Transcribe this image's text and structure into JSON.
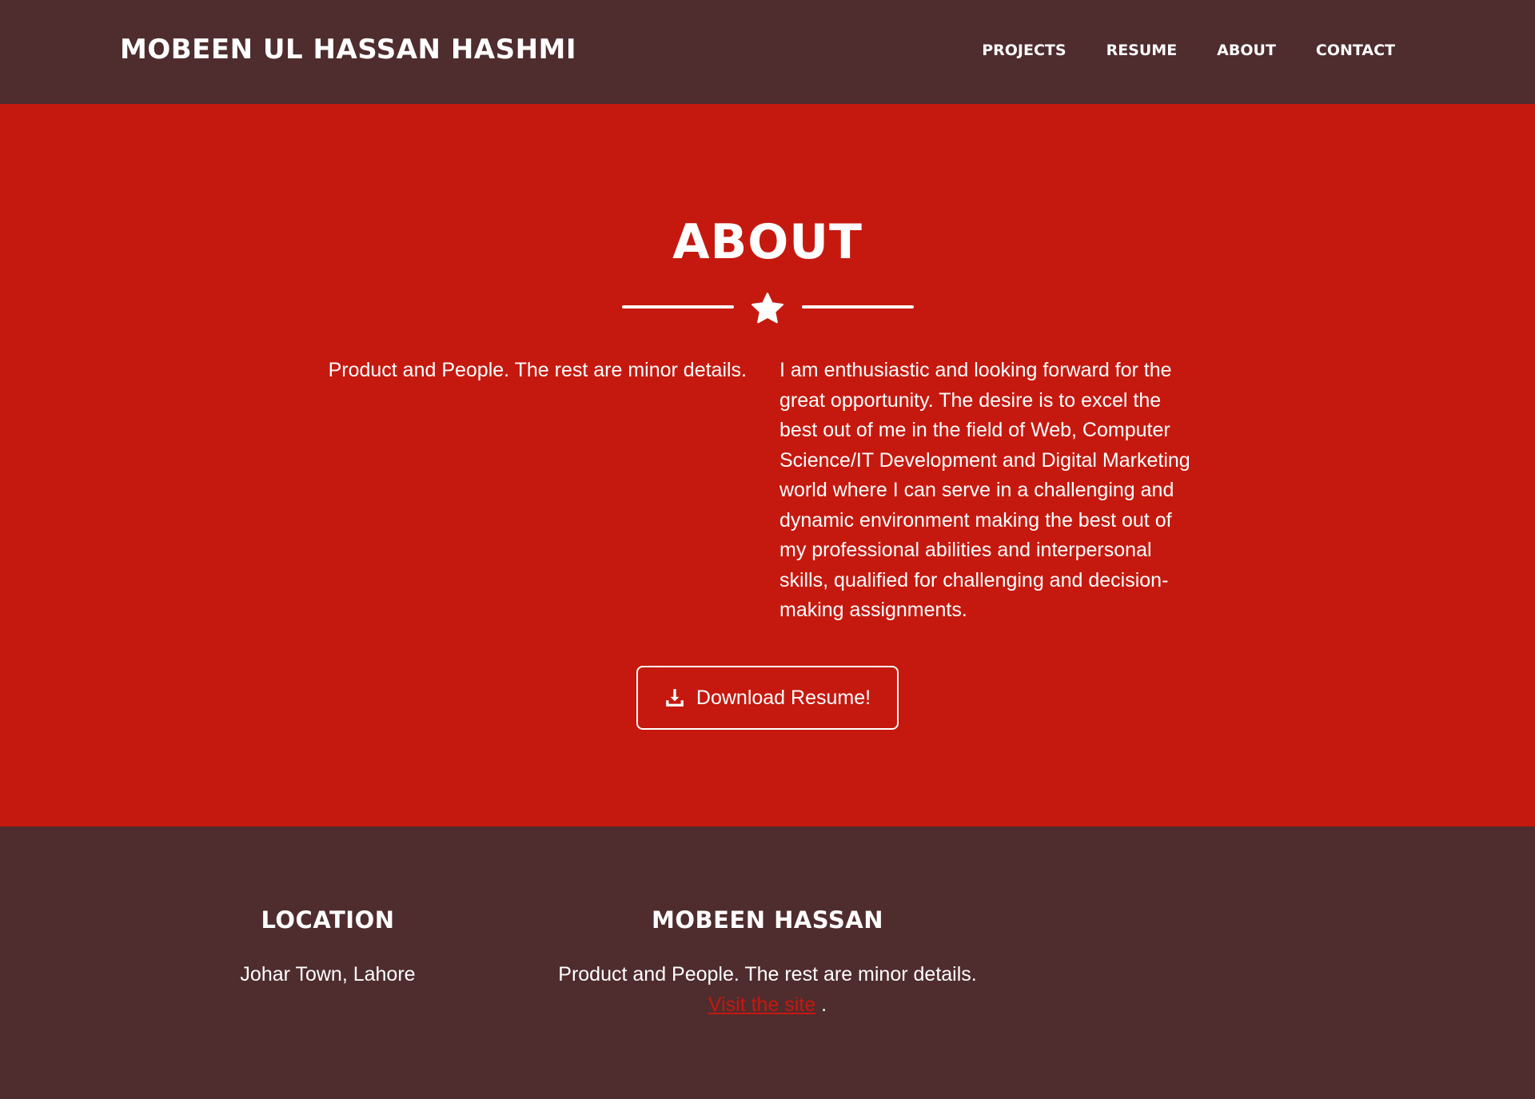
{
  "navbar": {
    "brand": "MOBEEN UL HASSAN HASHMI",
    "links": [
      {
        "label": "PROJECTS"
      },
      {
        "label": "RESUME"
      },
      {
        "label": "ABOUT"
      },
      {
        "label": "CONTACT"
      }
    ],
    "background": "#4f2c2e"
  },
  "about": {
    "title": "ABOUT",
    "divider_icon": "star-icon",
    "left_text": "Product and People. The rest are minor details.",
    "right_text": "I am enthusiastic and looking forward for the great opportunity. The desire is to excel the best out of me in the field of Web, Computer Science/IT Development and Digital Marketing world where I can serve in a challenging and dynamic environment making the best out of my professional abilities and interpersonal skills, qualified for challenging and decision-making assignments.",
    "download_label": "Download Resume!",
    "download_icon": "download-icon",
    "background": "#c5190f"
  },
  "footer": {
    "location_heading": "LOCATION",
    "location_text": "Johar Town, Lahore",
    "name_heading": "MOBEEN HASSAN",
    "name_text": "Product and People. The rest are minor details.",
    "visit_link": "Visit the site",
    "visit_suffix": ".",
    "link_color": "#c5190f",
    "background": "#4f2c2e"
  }
}
